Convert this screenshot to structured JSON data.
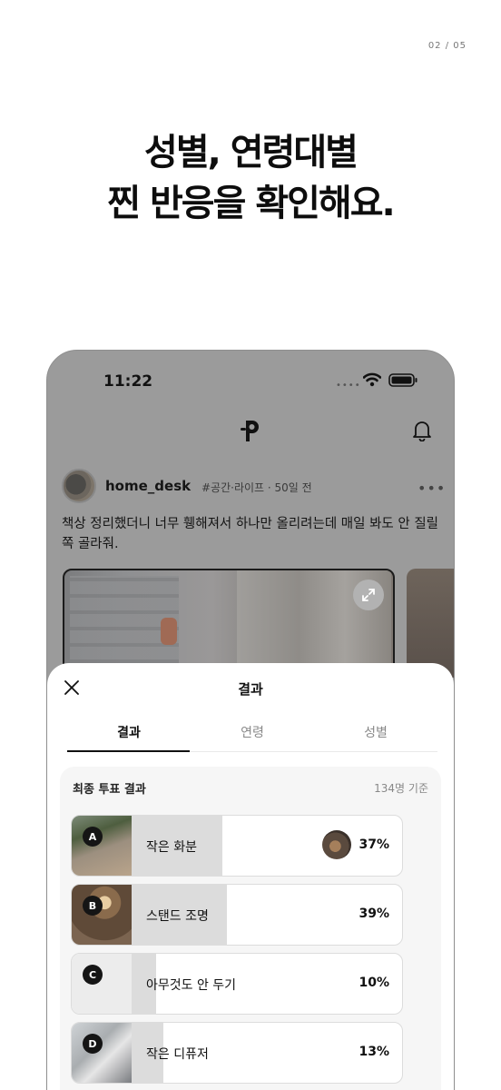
{
  "page_indicator": "02 / 05",
  "headline": {
    "line1": "성별, 연령대별",
    "line2": "찐 반응을 확인해요."
  },
  "phone": {
    "status_time": "11:22",
    "post": {
      "username": "home_desk",
      "tags_meta": "#공간·라이프 · 50일 전",
      "text": "책상 정리했더니 너무 휑해져서 하나만 올리려는데 매일 봐도 안 질릴 쪽 골라줘."
    }
  },
  "sheet": {
    "title": "결과",
    "tabs": [
      "결과",
      "연령",
      "성별"
    ],
    "active_tab": "결과",
    "results": {
      "title": "최종 투표 결과",
      "count": "134명 기준",
      "options": [
        {
          "letter": "A",
          "label": "작은 화분",
          "percent_text": "37%",
          "percent": 37,
          "has_voter_avatar": true
        },
        {
          "letter": "B",
          "label": "스탠드 조명",
          "percent_text": "39%",
          "percent": 39,
          "has_voter_avatar": false
        },
        {
          "letter": "C",
          "label": "아무것도 안 두기",
          "percent_text": "10%",
          "percent": 10,
          "has_voter_avatar": false
        },
        {
          "letter": "D",
          "label": "작은 디퓨저",
          "percent_text": "13%",
          "percent": 13,
          "has_voter_avatar": false
        }
      ]
    }
  },
  "colors": {
    "overlay": "#9b9b9b",
    "fill": "#dcdcdc",
    "badge": "#151515"
  },
  "icons": [
    "wifi-icon",
    "battery-icon",
    "app-logo-icon",
    "bell-icon",
    "more-icon",
    "expand-icon",
    "close-icon"
  ]
}
